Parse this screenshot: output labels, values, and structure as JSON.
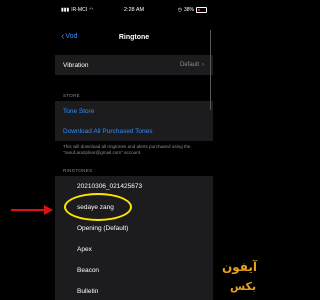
{
  "status_bar": {
    "carrier": "IR-MCI",
    "time": "2:28 AM",
    "battery": "38%"
  },
  "nav": {
    "back_label": "Vod",
    "title": "Ringtone"
  },
  "vibration": {
    "label": "Vibration",
    "value": "Default"
  },
  "store": {
    "header": "STORE",
    "tone_store": "Tone Store",
    "download_all": "Download All Purchased Tones",
    "note": "This will download all ringtones and alerts purchased using the \"raouf.arazploor@gmail.com\" account."
  },
  "ringtones": {
    "header": "RINGTONES",
    "items": [
      {
        "label": "20210306_021425673"
      },
      {
        "label": "sedaye zang"
      },
      {
        "label": "Opening (Default)"
      },
      {
        "label": "Apex"
      },
      {
        "label": "Beacon"
      },
      {
        "label": "Bulletin"
      }
    ]
  },
  "watermark": {
    "line1": "آیفون",
    "line2": "بکس"
  },
  "colors": {
    "accent": "#2f8dff",
    "highlight_circle": "#ffe600",
    "arrow": "#e01010",
    "watermark": "#e6a020"
  }
}
